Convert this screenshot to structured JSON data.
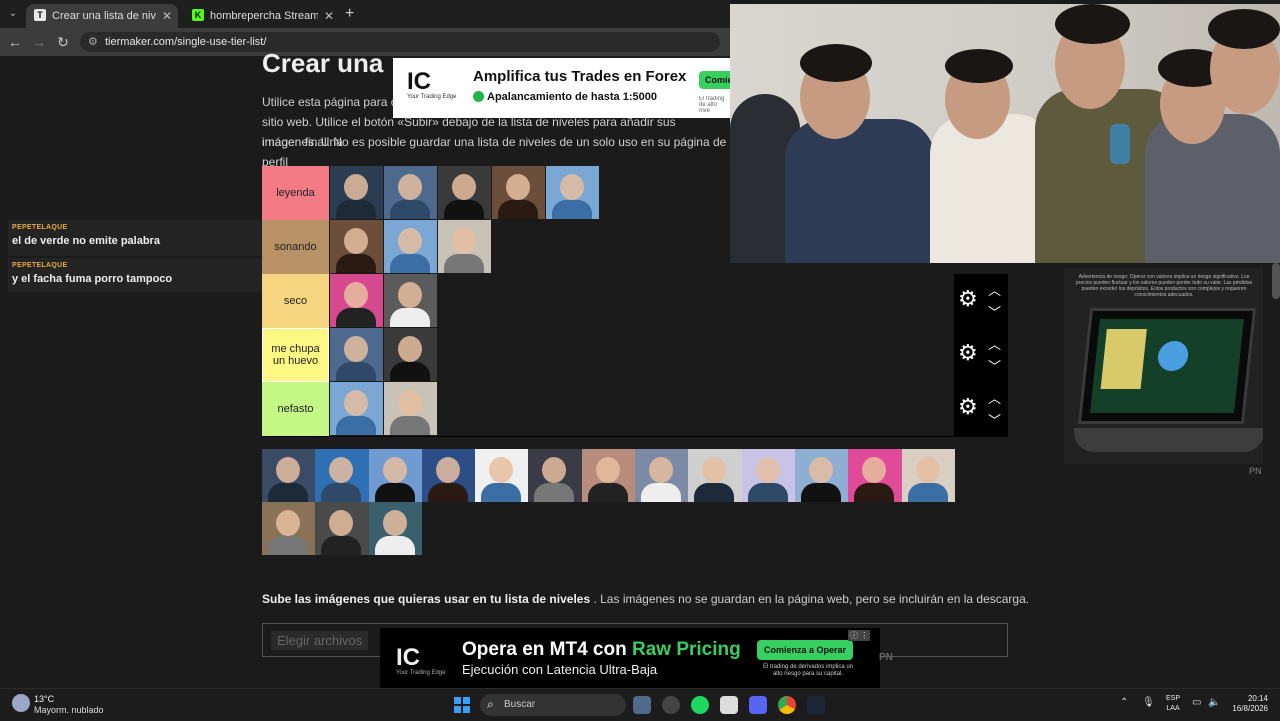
{
  "browser": {
    "tabs": [
      {
        "title": "Crear una lista de niveles de un solo uso",
        "active": true,
        "favicon": "tiermaker-icon"
      },
      {
        "title": "hombrepercha Stream - Watch",
        "active": false,
        "favicon": "kick-icon"
      }
    ],
    "url": "tiermaker.com/single-use-tier-list/"
  },
  "chat": [
    {
      "user": "PEPETELAQUE",
      "message": "el de verde no emite palabra"
    },
    {
      "user": "PEPETELAQUE",
      "message": "y el facha fuma porro tampoco"
    }
  ],
  "page": {
    "title": "Crear una",
    "intro_lines": [
      "Utilice esta página para cr",
      "sitio web. Utilice el botón «Subir» debajo de la lista de niveles para añadir sus imágenes. Una",
      "imagen final. No es posible guardar una lista de niveles de un solo uso en su página de perfil"
    ],
    "upload_bold": "Sube las imágenes que quieras usar en tu lista de niveles",
    "upload_rest": ". Las imágenes no se guardan en la página web, pero se incluirán en la descarga.",
    "upload_button": "Elegir archivos"
  },
  "tiers": [
    {
      "label": "leyenda",
      "color": "#f27b85",
      "count": 5,
      "selected": false,
      "controls": false
    },
    {
      "label": "sonando",
      "color": "#b89166",
      "count": 3,
      "selected": false,
      "controls": false
    },
    {
      "label": "seco",
      "color": "#f5d580",
      "count": 2,
      "selected": false,
      "controls": true
    },
    {
      "label": "me chupa un huevo",
      "color": "#fdf784",
      "count": 2,
      "selected": true,
      "controls": true
    },
    {
      "label": "nefasto",
      "color": "#c4f785",
      "count": 2,
      "selected": false,
      "controls": true
    }
  ],
  "pool_count": 16,
  "ads": {
    "top": {
      "logo": "IC",
      "logo_sub": "Your Trading Edge",
      "headline": "Amplifica tus Trades en Forex",
      "sub_prefix": "Apalancamiento de hasta ",
      "sub_value": "1:5000",
      "cta": "Comie",
      "fine": "El trading de alto nive"
    },
    "side": {
      "risk": "Advertencia de riesgo: Operar con valores implica un riesgo significativo. Los precios pueden fluctuar y los valores pueden perder todo su valor. Las pérdidas pueden exceder los depósitos. Estos productos son complejos y requieren conocimientos adecuados.",
      "tag": "PN"
    },
    "bottom": {
      "logo": "IC",
      "logo_sub": "Your Trading Edge",
      "headline_a": "Opera en MT4 con ",
      "headline_b": "Raw Pricing",
      "sub": "Ejecución con Latencia Ultra-Baja",
      "cta": "Comienza a Operar",
      "fine": "El trading de derivados implica un alto riesgo para su capital.",
      "tag": "PN"
    }
  },
  "taskbar": {
    "weather_temp": "13°C",
    "weather_desc": "Mayorm. nublado",
    "search": "Buscar",
    "lang_a": "ESP",
    "lang_b": "LAA",
    "time": "20:14",
    "date": "16/8/2026"
  }
}
